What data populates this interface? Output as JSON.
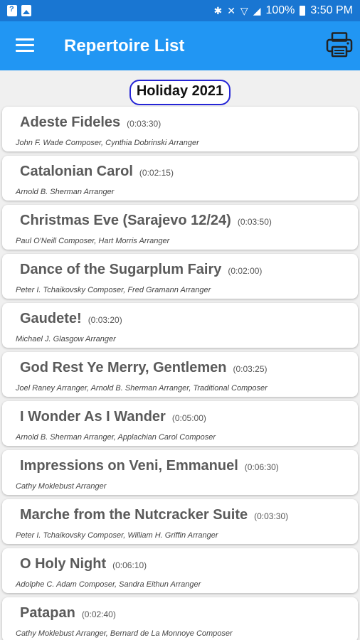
{
  "status_bar": {
    "battery": "100%",
    "time": "3:50 PM"
  },
  "app_bar": {
    "title": "Repertoire List"
  },
  "list": {
    "header": "Holiday 2021",
    "songs": [
      {
        "title": "Adeste Fideles",
        "duration": "(0:03:30)",
        "credits": "John F. Wade Composer, Cynthia Dobrinski Arranger"
      },
      {
        "title": "Catalonian Carol",
        "duration": "(0:02:15)",
        "credits": "Arnold B. Sherman Arranger"
      },
      {
        "title": "Christmas Eve (Sarajevo 12/24)",
        "duration": "(0:03:50)",
        "credits": "Paul O'Neill Composer, Hart Morris Arranger"
      },
      {
        "title": "Dance of the Sugarplum Fairy",
        "duration": "(0:02:00)",
        "credits": "Peter I. Tchaikovsky Composer, Fred Gramann Arranger"
      },
      {
        "title": "Gaudete!",
        "duration": "(0:03:20)",
        "credits": "Michael J. Glasgow Arranger"
      },
      {
        "title": "God Rest Ye Merry, Gentlemen",
        "duration": "(0:03:25)",
        "credits": "Joel Raney Arranger, Arnold B. Sherman Arranger, Traditional Composer"
      },
      {
        "title": "I Wonder As I Wander",
        "duration": "(0:05:00)",
        "credits": "Arnold B. Sherman Arranger, Applachian Carol Composer"
      },
      {
        "title": "Impressions on Veni, Emmanuel",
        "duration": "(0:06:30)",
        "credits": "Cathy Moklebust Arranger"
      },
      {
        "title": "Marche from the Nutcracker Suite",
        "duration": "(0:03:30)",
        "credits": "Peter I. Tchaikovsky Composer, William H. Griffin Arranger"
      },
      {
        "title": "O Holy Night",
        "duration": "(0:06:10)",
        "credits": "Adolphe C. Adam Composer, Sandra Eithun Arranger"
      },
      {
        "title": "Patapan",
        "duration": "(0:02:40)",
        "credits": "Cathy Moklebust Arranger, Bernard de La Monnoye Composer"
      }
    ]
  },
  "colors": {
    "status_bar": "#1976d2",
    "app_bar": "#2196f3",
    "header_border": "#2525d6"
  }
}
